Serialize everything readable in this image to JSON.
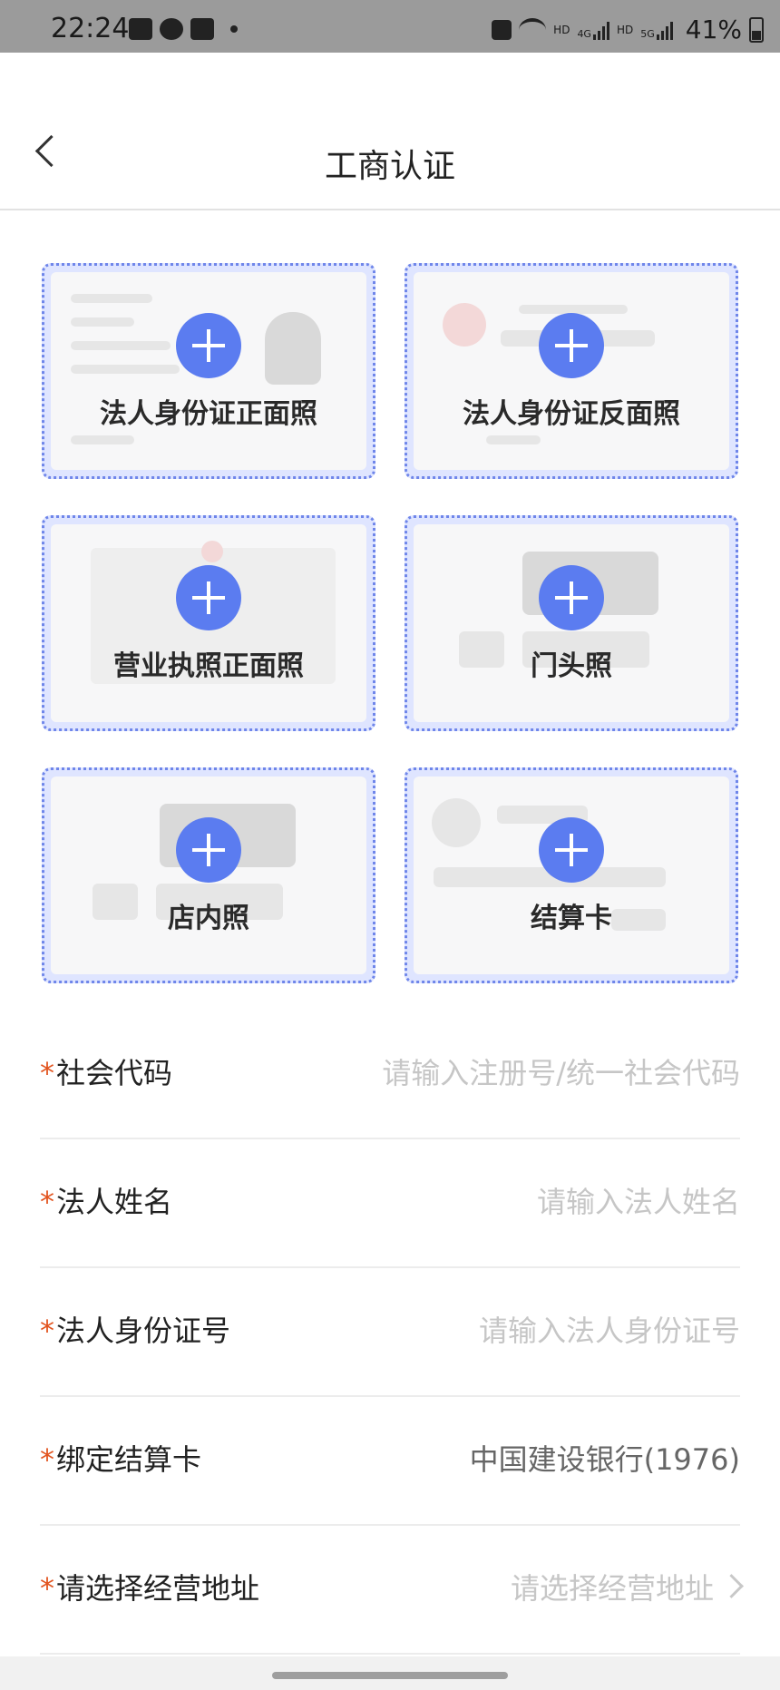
{
  "status_bar": {
    "time": "22:24",
    "left_icons": [
      "image-icon",
      "chat-icon",
      "calendar-21-icon",
      "dot-icon"
    ],
    "right_icons": [
      "data-transfer-icon",
      "wifi-icon",
      "hd-icon",
      "4g-signal-icon",
      "hd-icon",
      "5g-signal-icon"
    ],
    "hd1": "HD",
    "net1": "4G",
    "hd2": "HD",
    "net2": "5G",
    "battery_text": "41%"
  },
  "nav": {
    "back_icon": "chevron-left-icon",
    "title": "工商认证"
  },
  "upload_cards": [
    {
      "label": "法人身份证正面照",
      "icon": "plus-icon"
    },
    {
      "label": "法人身份证反面照",
      "icon": "plus-icon"
    },
    {
      "label": "营业执照正面照",
      "icon": "plus-icon"
    },
    {
      "label": "门头照",
      "icon": "plus-icon"
    },
    {
      "label": "店内照",
      "icon": "plus-icon"
    },
    {
      "label": "结算卡",
      "icon": "plus-icon"
    }
  ],
  "form": {
    "required_mark": "*",
    "fields": [
      {
        "label": "社会代码",
        "placeholder": "请输入注册号/统一社会代码"
      },
      {
        "label": "法人姓名",
        "placeholder": "请输入法人姓名"
      },
      {
        "label": "法人身份证号",
        "placeholder": "请输入法人身份证号"
      },
      {
        "label": "绑定结算卡",
        "value": "中国建设银行(1976)"
      },
      {
        "label": "请选择经营地址",
        "placeholder": "请选择经营地址",
        "icon": "chevron-right-icon"
      }
    ]
  },
  "colors": {
    "accent": "#5b7cf0",
    "required": "#e2541f",
    "card_border": "#6f86ea",
    "status_bar": "#9b9b9b"
  }
}
